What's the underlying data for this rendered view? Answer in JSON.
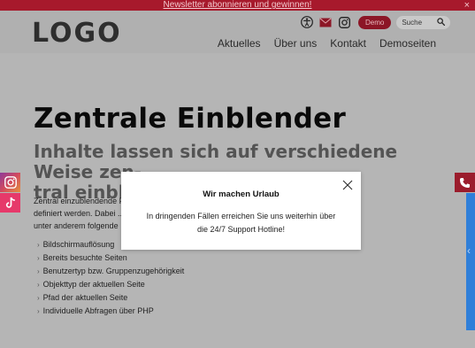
{
  "topbar": {
    "newsletter_link": "Newsletter abonnieren und gewinnen!",
    "close_glyph": "×",
    "background": "#a7192c"
  },
  "header": {
    "logo": "LOGO",
    "tools": {
      "icons": [
        "accessibility-icon",
        "mail-icon",
        "instagram-icon"
      ],
      "demo_label": "Demo",
      "search_placeholder": "Suche",
      "search_icon": "search-icon"
    },
    "nav": [
      "Aktuelles",
      "Über uns",
      "Kontakt",
      "Demoseiten"
    ]
  },
  "main": {
    "title": "Zentrale Einblender",
    "subtitle_line1": "Inhalte lassen sich auf verschiedene Weise zen-",
    "subtitle_line2": "tral einblenden",
    "paragraph_line1": "Zentral einzublendende Portalinhalte",
    "paragraph_line2": "definiert werden. Dabei ... hierfür eignen sich",
    "paragraph_line3": "unter anderem folgende",
    "bullets": [
      "Bildschirmauflösung",
      "Bereits besuchte Seiten",
      "Benutzertyp bzw. Gruppenzugehörigkeit",
      "Objekttyp der aktuellen Seite",
      "Pfad der aktuellen Seite",
      "Individuelle Abfragen über PHP"
    ]
  },
  "modal": {
    "title": "Wir machen Urlaub",
    "text_line1": "In dringenden Fällen erreichen Sie uns weiterhin über",
    "text_line2": "die 24/7 Support Hotline!"
  },
  "side": {
    "left_icons": [
      "instagram-icon",
      "tiktok-icon"
    ],
    "right_icons": [
      "phone-icon",
      "chevron-left-icon"
    ],
    "accent_red": "#9b1c2c",
    "accent_blue": "#2f7fd9"
  }
}
